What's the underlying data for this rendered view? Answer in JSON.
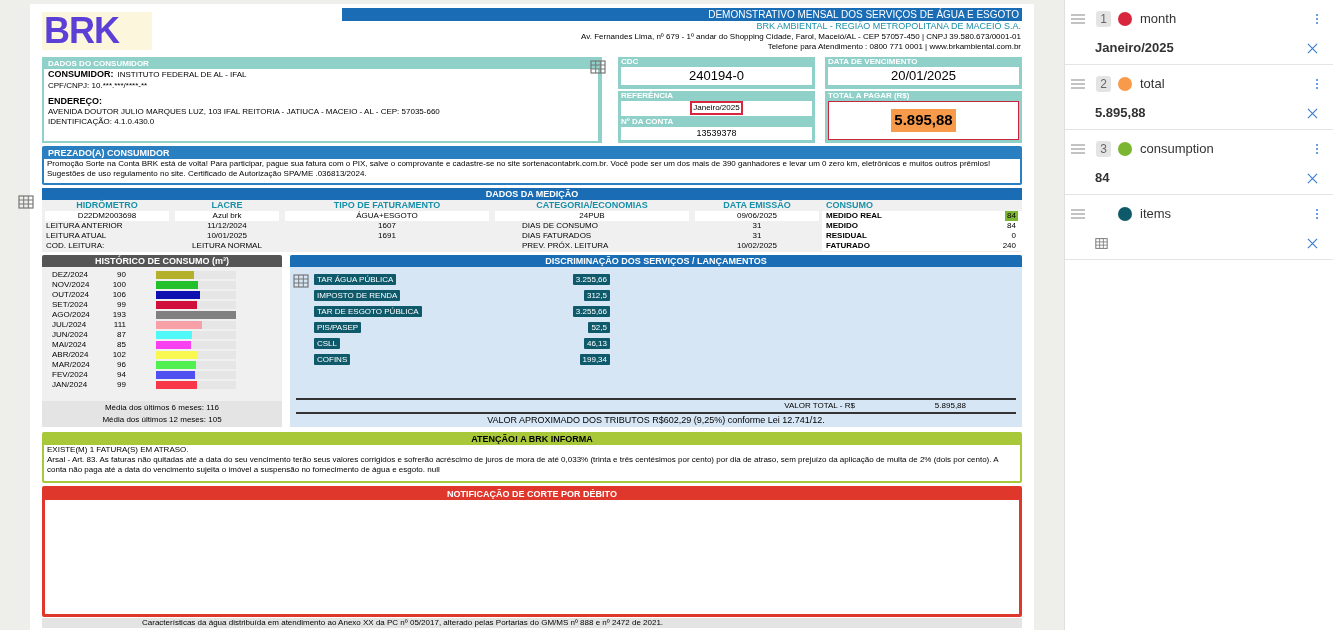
{
  "invoice": {
    "logo": "BRK",
    "title": "DEMONSTRATIVO MENSAL DOS SERVIÇOS DE ÁGUA E ESGOTO",
    "company": "BRK AMBIENTAL - REGIÃO METROPOLITANA DE MACEIÓ S.A.",
    "address": "Av. Fernandes Lima, nº 679 - 1º andar do Shopping Cidade, Farol, Maceió/AL - CEP 57057-450 | CNPJ 39.580.673/0001-01",
    "phone": "Telefone para Atendimento : 0800 771 0001 | www.brkambiental.com.br",
    "consumer": {
      "heading": "DADOS DO CONSUMIDOR",
      "name_label": "CONSUMIDOR:",
      "name": "INSTITUTO FEDERAL DE AL - IFAL",
      "document": "CPF/CNPJ: 10.***.***/****-**",
      "address_label": "ENDEREÇO:",
      "address": "AVENIDA DOUTOR JULIO MARQUES LUZ, 103 IFAL REITORIA - JATIUCA - MACEIO - AL - CEP: 57035-660",
      "identification": "IDENTIFICAÇÃO: 4.1.0.430.0"
    },
    "cdc": {
      "label": "CDC",
      "value": "240194-0"
    },
    "due_date": {
      "label": "DATA DE VENCIMENTO",
      "value": "20/01/2025"
    },
    "reference": {
      "label": "REFERÊNCIA",
      "value": "Janeiro/2025",
      "color": "#d7263d"
    },
    "account": {
      "label": "Nº DA CONTA",
      "value": "13539378"
    },
    "total": {
      "label": "TOTAL A PAGAR (R$)",
      "value": "5.895,88",
      "color": "#f79a4a"
    },
    "notice": {
      "heading": "PREZADO(A) CONSUMIDOR",
      "text": "Promoção Sorte na Conta BRK está de volta! Para participar, pague sua fatura com o PIX, salve o comprovante e cadastre-se no site sortenacontabrk.com.br. Você pode ser um  dos mais de 390 ganhadores e levar um 0 zero km, eletrônicos e muitos outros prêmios!  Sugestões de uso regulamento no site. Certificado de Autorização SPA/ME .036813/2024."
    },
    "measurement": {
      "heading": "DADOS DA MEDIÇÃO",
      "columns": [
        "HIDRÔMETRO",
        "LACRE",
        "TIPO DE FATURAMENTO",
        "CATEGORIA/ECONOMIAS",
        "DATA EMISSÃO",
        "CONSUMO"
      ],
      "meter": [
        "D22DM2003698",
        "Azul brk",
        "ÁGUA+ESGOTO",
        "24PUB",
        "09/06/2025"
      ],
      "readings": [
        {
          "label": "LEITURA ANTERIOR",
          "date": "11/12/2024",
          "reading": "1607",
          "label2": "DIAS DE CONSUMO",
          "value2": "31"
        },
        {
          "label": "LEITURA ATUAL",
          "date": "10/01/2025",
          "reading": "1691",
          "label2": "DIAS FATURADOS",
          "value2": "31"
        },
        {
          "label": "COD. LEITURA:",
          "date": "LEITURA NORMAL",
          "label2": "PREV. PRÓX. LEITURA",
          "value2": "10/02/2025"
        }
      ],
      "consumption": [
        {
          "label": "MEDIDO REAL",
          "value": "84",
          "color": "#7cb530"
        },
        {
          "label": "MEDIDO",
          "value": "84"
        },
        {
          "label": "RESIDUAL",
          "value": "0"
        },
        {
          "label": "FATURADO",
          "value": "240"
        }
      ]
    },
    "history": {
      "heading": "HISTÓRICO DE CONSUMO (m³)",
      "months": [
        {
          "month": "DEZ/2024",
          "value": "90",
          "level": 0.47,
          "color": "#b5b02a"
        },
        {
          "month": "NOV/2024",
          "value": "100",
          "level": 0.52,
          "color": "#22c02a"
        },
        {
          "month": "OUT/2024",
          "value": "106",
          "level": 0.55,
          "color": "#1010b0"
        },
        {
          "month": "SET/2024",
          "value": "99",
          "level": 0.51,
          "color": "#d0103a"
        },
        {
          "month": "AGO/2024",
          "value": "193",
          "level": 1.0,
          "color": "#808080"
        },
        {
          "month": "JUL/2024",
          "value": "111",
          "level": 0.58,
          "color": "#f8a0a8"
        },
        {
          "month": "JUN/2024",
          "value": "87",
          "level": 0.45,
          "color": "#50f8f8"
        },
        {
          "month": "MAI/2024",
          "value": "85",
          "level": 0.44,
          "color": "#f840f0"
        },
        {
          "month": "ABR/2024",
          "value": "102",
          "level": 0.53,
          "color": "#f8f850"
        },
        {
          "month": "MAR/2024",
          "value": "96",
          "level": 0.5,
          "color": "#50f050"
        },
        {
          "month": "FEV/2024",
          "value": "94",
          "level": 0.49,
          "color": "#5050f0"
        },
        {
          "month": "JAN/2024",
          "value": "99",
          "level": 0.51,
          "color": "#f83848"
        }
      ],
      "average_6": "Média dos últimos 6 meses: 116",
      "average_12": "Média dos últimos 12 meses: 105"
    },
    "services": {
      "heading": "DISCRIMINAÇÃO DOS SERVIÇOS / LANÇAMENTOS",
      "items": [
        {
          "description": "TAR ÁGUA PÚBLICA",
          "amount": "3.255,66"
        },
        {
          "description": "IMPOSTO DE RENDA",
          "amount": "312,5"
        },
        {
          "description": "TAR DE ESGOTO PÚBLICA",
          "amount": "3.255,66"
        },
        {
          "description": "PIS/PASEP",
          "amount": "52,5"
        },
        {
          "description": "CSLL",
          "amount": "46,13"
        },
        {
          "description": "COFINS",
          "amount": "199,34"
        }
      ],
      "total_label": "VALOR TOTAL - R$",
      "total": "5.895,88",
      "taxes": "VALOR APROXIMADO DOS TRIBUTOS R$602,29 (9,25%) conforme Lei 12.741/12."
    },
    "attention": {
      "heading": "ATENÇÃO! A BRK INFORMA",
      "lines": [
        "EXISTE(M) 1 FATURA(S) EM ATRASO.",
        "Arsal - Art. 83. As faturas não quitadas até a data do seu vencimento terão seus valores corrigidos e sofrerão acréscimo de juros de mora de até 0,033% (trinta e três centésimos por cento) por dia de atraso, sem prejuízo da aplicação de multa de 2% (dois por cento). A conta não paga até a data do vencimento sujeita o imóvel a suspensão no fornecimento de água e esgoto.  null"
      ]
    },
    "cut_notice": {
      "heading": "NOTIFICAÇÃO DE CORTE POR DÉBITO"
    },
    "footer": "Características da água distribuída em atendimento ao Anexo XX da PC nº 05/2017, alterado pelas Portarias do GM/MS nº 888 e nº 2472 de 2021."
  },
  "fields": [
    {
      "index": "1",
      "color": "#d7263d",
      "name": "month",
      "kind": "text",
      "value": "Janeiro/2025"
    },
    {
      "index": "2",
      "color": "#f79a4a",
      "name": "total",
      "kind": "text",
      "value": "5.895,88"
    },
    {
      "index": "3",
      "color": "#7cb530",
      "name": "consumption",
      "kind": "text",
      "value": "84"
    },
    {
      "color": "#0e5a6b",
      "name": "items",
      "kind": "table"
    }
  ]
}
